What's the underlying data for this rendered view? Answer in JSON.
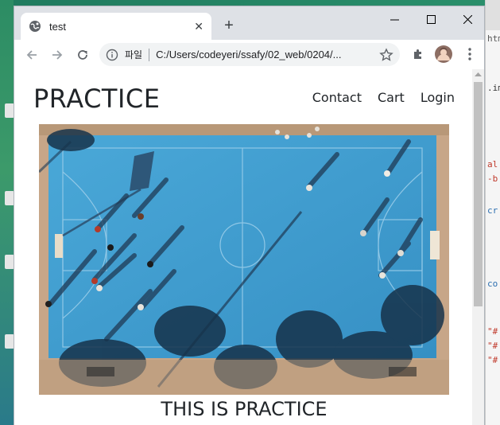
{
  "browser": {
    "tab_title": "test",
    "address_label": "파일",
    "url": "C:/Users/codeyeri/ssafy/02_web/0204/..."
  },
  "page": {
    "brand": "PRACTICE",
    "nav": [
      "Contact",
      "Cart",
      "Login"
    ],
    "caption": "THIS IS PRACTICE",
    "hero_image": "aerial-basketball-court-photo"
  },
  "desktop_right": {
    "fragments": [
      "htm",
      ".ima",
      "al",
      "-b",
      "cr",
      "co",
      "\"#",
      "\"#",
      "\"#"
    ]
  },
  "colors": {
    "court_blue": "#3f9fd0",
    "court_sand": "#c9a888",
    "chrome_frame": "#dee1e6"
  }
}
